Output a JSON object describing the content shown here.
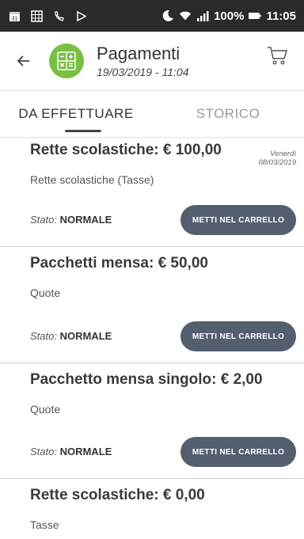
{
  "status_bar": {
    "left_icons": [
      "calendar-icon",
      "grid-icon",
      "phone-icon",
      "play-icon"
    ],
    "battery": "100%",
    "time": "11:05"
  },
  "header": {
    "title": "Pagamenti",
    "subtitle": "19/03/2019 - 11:04",
    "accent": "#78c043"
  },
  "tabs": [
    {
      "label": "DA EFFETTUARE",
      "active": true
    },
    {
      "label": "STORICO",
      "active": false
    }
  ],
  "items": [
    {
      "title": "Rette scolastiche: € 100,00",
      "date_line1": "Venerdì",
      "date_line2": "08/03/2019",
      "desc": "Rette scolastiche (Tasse)",
      "stato_label": "Stato:",
      "stato_value": "NORMALE",
      "button": "METTI NEL CARRELLO"
    },
    {
      "title": "Pacchetti mensa: € 50,00",
      "desc": "Quote",
      "stato_label": "Stato:",
      "stato_value": "NORMALE",
      "button": "METTI NEL CARRELLO"
    },
    {
      "title": "Pacchetto mensa singolo: € 2,00",
      "desc": "Quote",
      "stato_label": "Stato:",
      "stato_value": "NORMALE",
      "button": "METTI NEL CARRELLO"
    },
    {
      "title": "Rette scolastiche: € 0,00",
      "desc": "Tasse"
    }
  ],
  "colors": {
    "button_bg": "#555e6f",
    "statusbar_bg": "#2a2a2a"
  }
}
